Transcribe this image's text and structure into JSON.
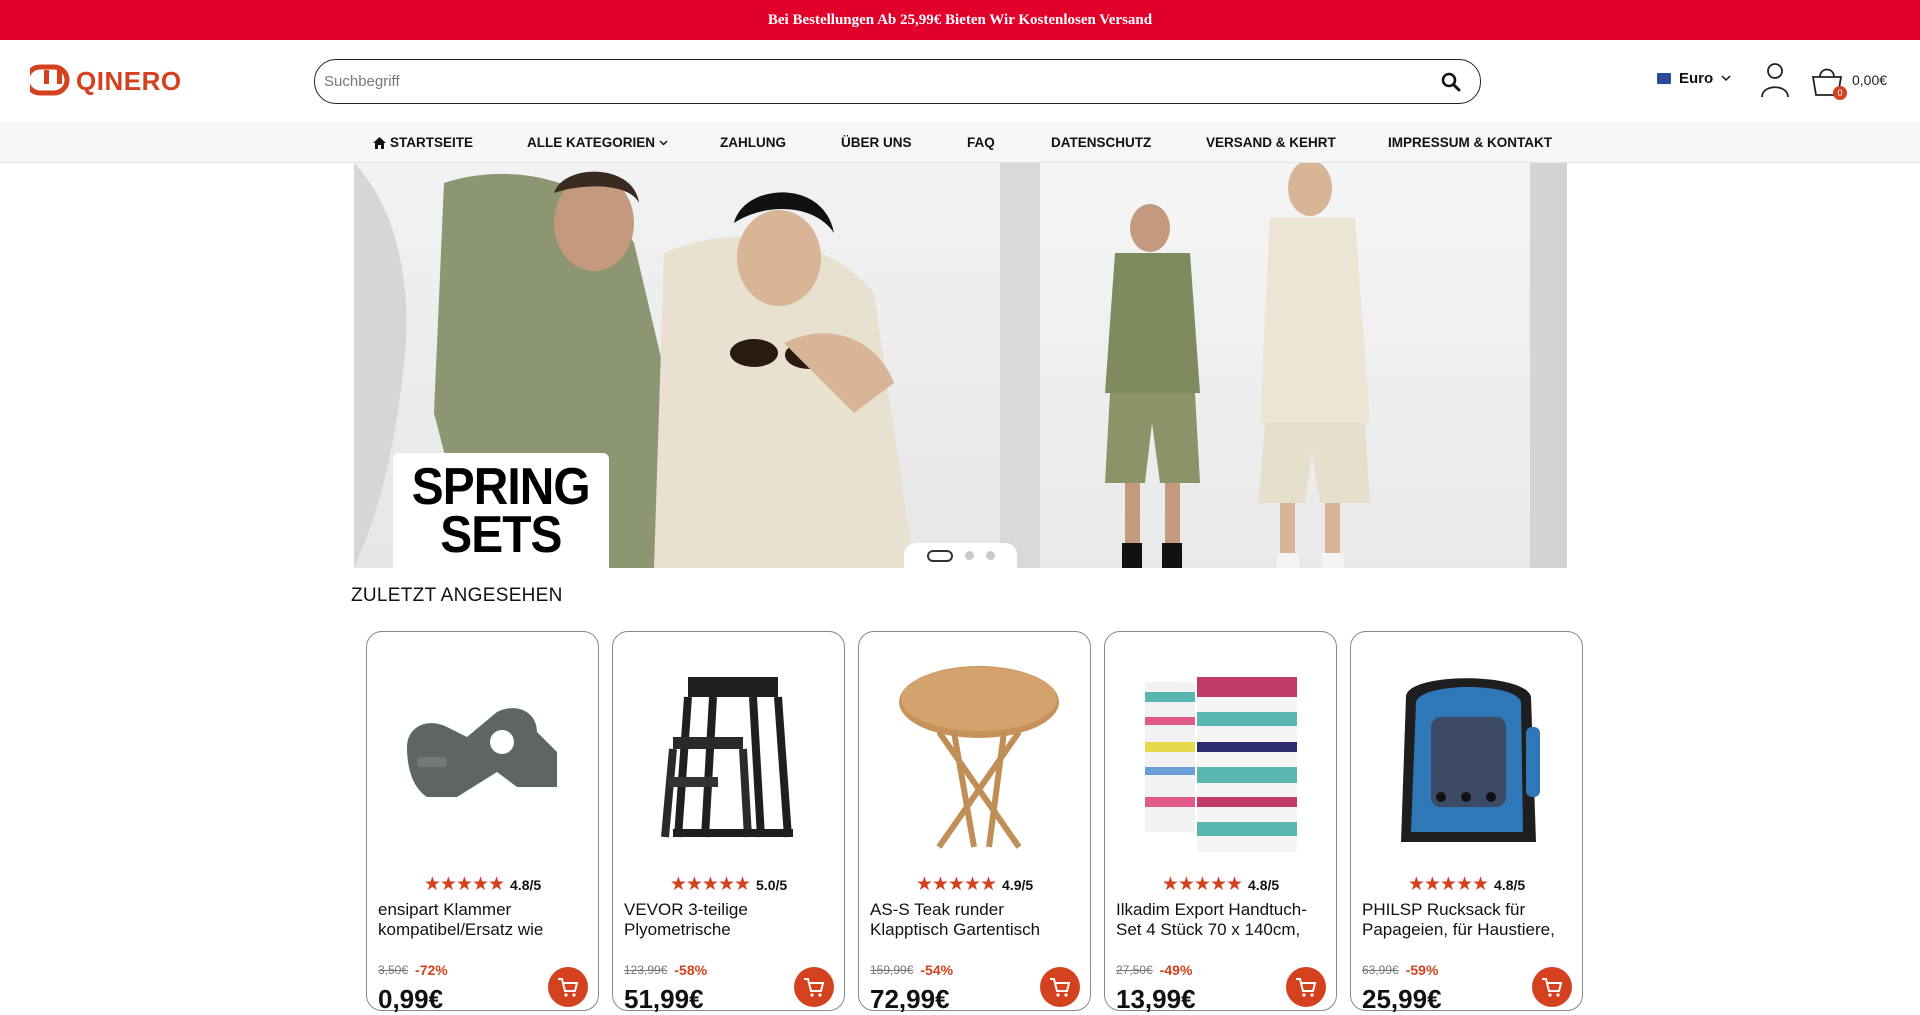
{
  "promo": {
    "text": "Bei Bestellungen Ab 25,99€ Bieten Wir Kostenlosen Versand"
  },
  "brand": {
    "name": "QINERO",
    "color": "#d4411e"
  },
  "search": {
    "placeholder": "Suchbegriff"
  },
  "currency": {
    "label": "Euro"
  },
  "cart": {
    "count": "0",
    "total": "0,00€"
  },
  "nav": {
    "items": [
      {
        "label": "STARTSEITE",
        "icon": "home-icon"
      },
      {
        "label": "ALLE KATEGORIEN",
        "icon": "chevron-down-icon"
      },
      {
        "label": "ZAHLUNG"
      },
      {
        "label": "ÜBER UNS"
      },
      {
        "label": "FAQ"
      },
      {
        "label": "DATENSCHUTZ"
      },
      {
        "label": "VERSAND & KEHRT"
      },
      {
        "label": "IMPRESSUM & KONTAKT"
      }
    ]
  },
  "hero": {
    "line1": "SPRING",
    "line2": "SETS",
    "slides": 3,
    "active_slide": 1
  },
  "recent": {
    "title": "ZULETZT ANGESEHEN",
    "products": [
      {
        "rating": "4.8/5",
        "title": "ensipart Klammer kompatibel/Ersatz wie",
        "old_price": "3,50€",
        "discount": "-72%",
        "price": "0,99€"
      },
      {
        "rating": "5.0/5",
        "title": "VEVOR 3-teilige Plyometrische",
        "old_price": "123,99€",
        "discount": "-58%",
        "price": "51,99€"
      },
      {
        "rating": "4.9/5",
        "title": "AS-S Teak runder Klapptisch Gartentisch",
        "old_price": "159,99€",
        "discount": "-54%",
        "price": "72,99€"
      },
      {
        "rating": "4.8/5",
        "title": "Ilkadim Export Handtuch-Set 4 Stück 70 x 140cm,",
        "old_price": "27,50€",
        "discount": "-49%",
        "price": "13,99€"
      },
      {
        "rating": "4.8/5",
        "title": "PHILSP Rucksack für Papageien, für Haustiere,",
        "old_price": "63,99€",
        "discount": "-59%",
        "price": "25,99€"
      }
    ]
  }
}
